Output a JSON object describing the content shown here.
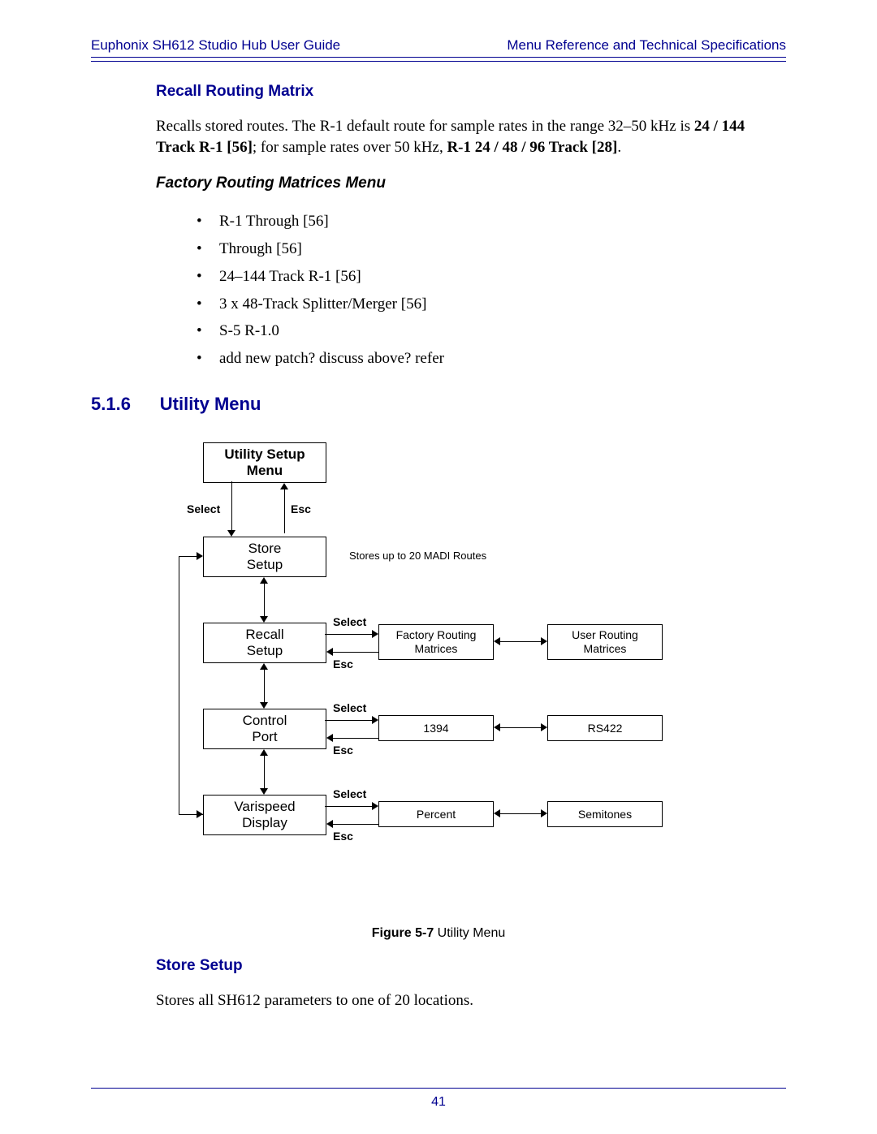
{
  "header": {
    "left": "Euphonix SH612 Studio Hub User Guide",
    "right": "Menu Reference and Technical Specifications"
  },
  "page_number": "41",
  "sections": {
    "recall_routing": {
      "title": "Recall Routing Matrix",
      "para_a": "Recalls stored routes. The R-1 default route for sample rates in the range 32–50 kHz is ",
      "bold_a": "24 / 144 Track R-1 [56]",
      "para_b": "; for sample rates over 50 kHz, ",
      "bold_b": "R-1 24 / 48 / 96 Track [28]",
      "tail": "."
    },
    "factory_menu": {
      "title": "Factory Routing Matrices Menu",
      "items": [
        "R-1 Through [56]",
        "Through [56]",
        "24–144 Track R-1 [56]",
        "3 x 48-Track Splitter/Merger [56]",
        "S-5 R-1.0",
        "add new patch? discuss above? refer"
      ]
    },
    "utility": {
      "num": "5.1.6",
      "title": "Utility Menu"
    },
    "store_setup": {
      "title": "Store Setup",
      "para": "Stores all SH612 parameters to one of 20 locations."
    }
  },
  "diagram": {
    "top_box": "Utility Setup\nMenu",
    "select": "Select",
    "esc": "Esc",
    "store": "Store\nSetup",
    "store_note": "Stores up to 20 MADI Routes",
    "recall": "Recall\nSetup",
    "control": "Control\nPort",
    "vari": "Varispeed\nDisplay",
    "factory": "Factory Routing\nMatrices",
    "user": "User Routing\nMatrices",
    "p1394": "1394",
    "rs422": "RS422",
    "percent": "Percent",
    "semitones": "Semitones",
    "caption_b": "Figure 5-7",
    "caption_t": " Utility Menu"
  },
  "chart_data": {
    "type": "diagram",
    "title": "Utility Menu",
    "nodes": [
      {
        "id": "utility_setup",
        "label": "Utility Setup Menu"
      },
      {
        "id": "store_setup",
        "label": "Store Setup",
        "note": "Stores up to 20 MADI Routes"
      },
      {
        "id": "recall_setup",
        "label": "Recall Setup"
      },
      {
        "id": "control_port",
        "label": "Control Port"
      },
      {
        "id": "varispeed",
        "label": "Varispeed Display"
      },
      {
        "id": "factory_matrices",
        "label": "Factory Routing Matrices"
      },
      {
        "id": "user_matrices",
        "label": "User Routing Matrices"
      },
      {
        "id": "1394",
        "label": "1394"
      },
      {
        "id": "rs422",
        "label": "RS422"
      },
      {
        "id": "percent",
        "label": "Percent"
      },
      {
        "id": "semitones",
        "label": "Semitones"
      }
    ],
    "edges": [
      {
        "from": "utility_setup",
        "to": "store_setup",
        "label_forward": "Select",
        "label_back": "Esc"
      },
      {
        "from": "store_setup",
        "to": "recall_setup",
        "bidirectional": true
      },
      {
        "from": "recall_setup",
        "to": "control_port",
        "bidirectional": true
      },
      {
        "from": "control_port",
        "to": "varispeed",
        "bidirectional": true
      },
      {
        "from": "varispeed",
        "to": "store_setup",
        "wrap": true
      },
      {
        "from": "recall_setup",
        "to": "factory_matrices",
        "label_forward": "Select",
        "label_back": "Esc"
      },
      {
        "from": "factory_matrices",
        "to": "user_matrices",
        "bidirectional": true
      },
      {
        "from": "control_port",
        "to": "1394",
        "label_forward": "Select",
        "label_back": "Esc"
      },
      {
        "from": "1394",
        "to": "rs422",
        "bidirectional": true
      },
      {
        "from": "varispeed",
        "to": "percent",
        "label_forward": "Select",
        "label_back": "Esc"
      },
      {
        "from": "percent",
        "to": "semitones",
        "bidirectional": true
      }
    ]
  }
}
